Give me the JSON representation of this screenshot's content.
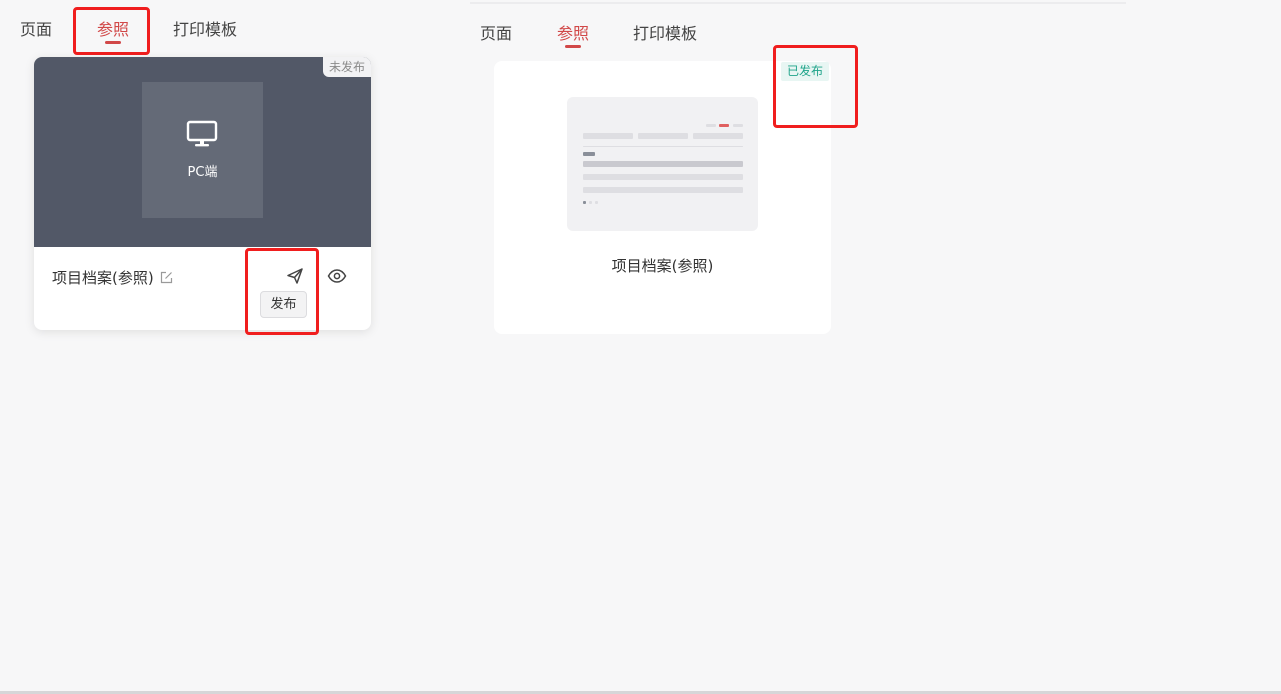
{
  "left_panel": {
    "tabs": [
      {
        "label": "页面",
        "active": false
      },
      {
        "label": "参照",
        "active": true
      },
      {
        "label": "打印模板",
        "active": false
      }
    ],
    "card": {
      "status": "未发布",
      "platform_label": "PC端",
      "title": "项目档案(参照)",
      "publish_tooltip": "发布",
      "icons": {
        "platform": "monitor-icon",
        "edit": "edit-icon",
        "publish": "send-icon",
        "preview": "eye-icon"
      }
    }
  },
  "right_panel": {
    "tabs": [
      {
        "label": "页面",
        "active": false
      },
      {
        "label": "参照",
        "active": true
      },
      {
        "label": "打印模板",
        "active": false
      }
    ],
    "card": {
      "status": "已发布",
      "title": "项目档案(参照)"
    }
  },
  "colors": {
    "accent": "#d14848",
    "annotation": "#f01e1e",
    "published": "#1fa48a",
    "preview_bg": "#525867"
  }
}
